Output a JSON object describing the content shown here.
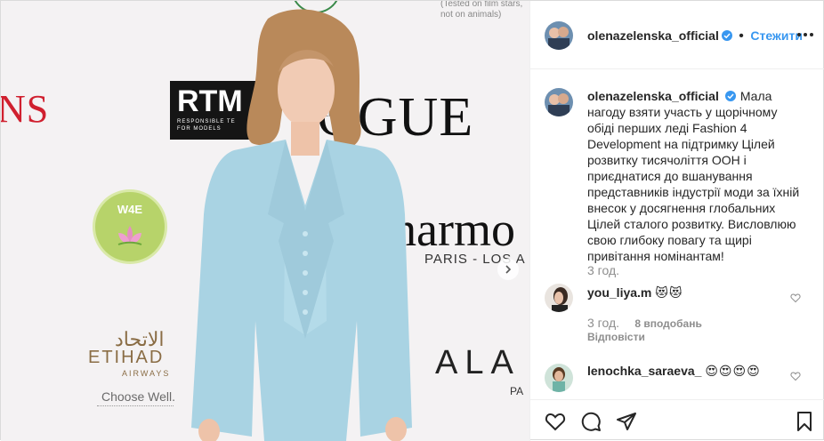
{
  "photo": {
    "brands": {
      "ns": "NS",
      "rtm": "RTM",
      "rtm_sub_1": "RESPONSIBLE TE",
      "rtm_sub_2": "FOR MODELS",
      "vogue": "OGUE",
      "italia": "ITALIA",
      "harmo": "harmo",
      "paris": "PARIS - LOS A",
      "alaia": "ALA",
      "pa": "PA",
      "etihad_ar": "الاتحاد",
      "etihad": "ETIHAD",
      "airways": "AIRWAYS",
      "choose": "Choose Well.",
      "top_note_1": "(Tested on film stars,",
      "top_note_2": "not on animals)",
      "w4e": "W4E"
    }
  },
  "header": {
    "username": "olenazelenska_official",
    "separator": "•",
    "follow_label": "Стежити"
  },
  "caption": {
    "username": "olenazelenska_official",
    "text": "Мала нагоду взяти участь у щорічному обіді перших леді Fashion 4 Development на підтримку Цілей розвитку тисячоліття ООН і приєднатися до вшанування представників індустрії моди за їхній внесок у досягнення глобальних Цілей сталого розвитку. Висловлюю свою глибоку повагу та щирі привітання номінантам!",
    "time": "3 год."
  },
  "comments": [
    {
      "username": "you_liya.m",
      "text": "😻😻",
      "time": "3 год.",
      "likes": "8 вподобань",
      "reply": "Відповісти"
    },
    {
      "username": "lenochka_saraeva_",
      "text": "😍😍😍😍"
    }
  ],
  "colors": {
    "accent": "#3897f0",
    "suit": "#a9d3e3",
    "text": "#262626",
    "muted": "#8e8e8e"
  }
}
